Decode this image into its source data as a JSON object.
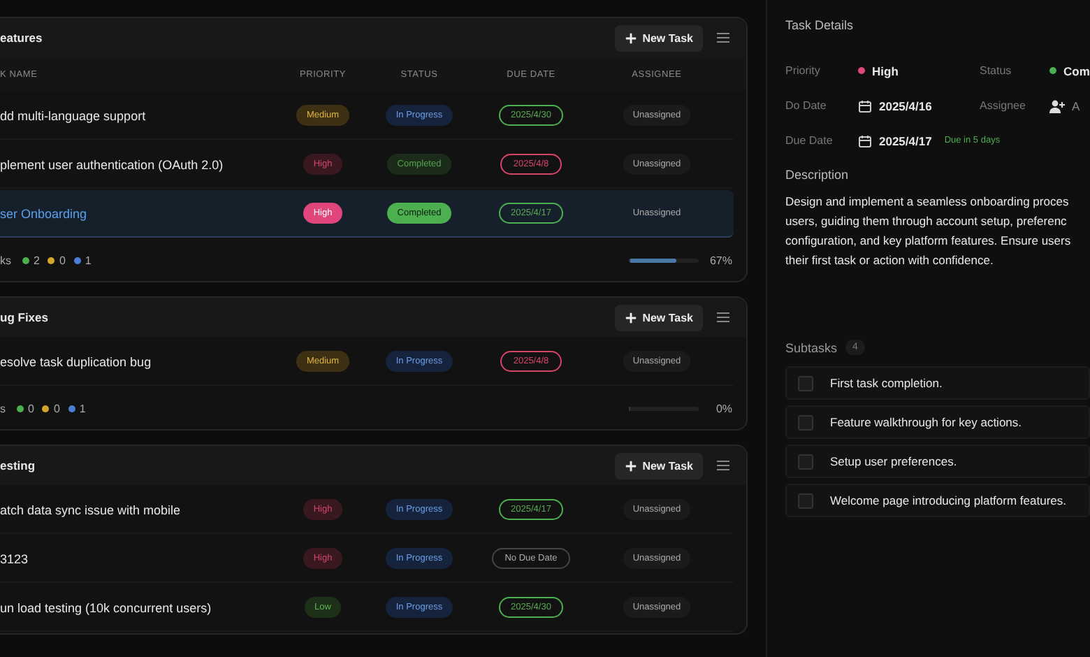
{
  "groups": [
    {
      "title": "eatures",
      "new_task": "New Task",
      "columns": [
        "K NAME",
        "PRIORITY",
        "STATUS",
        "DUE DATE",
        "ASSIGNEE"
      ],
      "tasks": [
        {
          "name": "dd multi-language support",
          "selected": false,
          "priority": {
            "label": "Medium",
            "kind": "medium"
          },
          "status": {
            "label": "In Progress",
            "kind": "progress"
          },
          "due": {
            "label": "2025/4/30",
            "kind": "ok"
          },
          "assignee": "Unassigned"
        },
        {
          "name": "plement user authentication (OAuth 2.0)",
          "selected": false,
          "priority": {
            "label": "High",
            "kind": "high"
          },
          "status": {
            "label": "Completed",
            "kind": "done"
          },
          "due": {
            "label": "2025/4/8",
            "kind": "overdue"
          },
          "assignee": "Unassigned"
        },
        {
          "name": "ser Onboarding",
          "selected": true,
          "priority": {
            "label": "High",
            "kind": "high"
          },
          "status": {
            "label": "Completed",
            "kind": "done"
          },
          "due": {
            "label": "2025/4/17",
            "kind": "ok"
          },
          "assignee": "Unassigned"
        }
      ],
      "footer": {
        "label": "ks",
        "counts": [
          {
            "value": "2",
            "color": "#4caf50"
          },
          {
            "value": "0",
            "color": "#d4a72c"
          },
          {
            "value": "1",
            "color": "#4a7fd4"
          }
        ],
        "level": 0.67,
        "percent": "67%"
      }
    },
    {
      "title": "ug Fixes",
      "new_task": "New Task",
      "tasks": [
        {
          "name": "esolve task duplication bug",
          "selected": false,
          "priority": {
            "label": "Medium",
            "kind": "medium"
          },
          "status": {
            "label": "In Progress",
            "kind": "progress"
          },
          "due": {
            "label": "2025/4/8",
            "kind": "overdue"
          },
          "assignee": "Unassigned"
        }
      ],
      "footer": {
        "label": "s",
        "counts": [
          {
            "value": "0",
            "color": "#4caf50"
          },
          {
            "value": "0",
            "color": "#d4a72c"
          },
          {
            "value": "1",
            "color": "#4a7fd4"
          }
        ],
        "level": 0,
        "percent": "0%"
      }
    },
    {
      "title": "esting",
      "new_task": "New Task",
      "tasks": [
        {
          "name": "atch data sync issue with mobile",
          "selected": false,
          "priority": {
            "label": "High",
            "kind": "high"
          },
          "status": {
            "label": "In Progress",
            "kind": "progress"
          },
          "due": {
            "label": "2025/4/17",
            "kind": "ok"
          },
          "assignee": "Unassigned"
        },
        {
          "name": "3123",
          "selected": false,
          "priority": {
            "label": "High",
            "kind": "high"
          },
          "status": {
            "label": "In Progress",
            "kind": "progress"
          },
          "due": {
            "label": "No Due Date",
            "kind": "none"
          },
          "assignee": "Unassigned"
        },
        {
          "name": "un load testing (10k concurrent users)",
          "selected": false,
          "priority": {
            "label": "Low",
            "kind": "low"
          },
          "status": {
            "label": "In Progress",
            "kind": "progress"
          },
          "due": {
            "label": "2025/4/30",
            "kind": "ok"
          },
          "assignee": "Unassigned"
        }
      ]
    }
  ],
  "details": {
    "title": "Task Details",
    "priority": {
      "label": "Priority",
      "value": "High",
      "color": "#e0457b"
    },
    "status": {
      "label": "Status",
      "value": "Com",
      "color": "#4caf50"
    },
    "do_date": {
      "label": "Do Date",
      "value": "2025/4/16"
    },
    "assignee": {
      "label": "Assignee",
      "value": "A"
    },
    "due_date": {
      "label": "Due Date",
      "value": "2025/4/17",
      "note": "Due in 5 days"
    },
    "description_title": "Description",
    "description_lines": [
      "Design and implement a seamless onboarding proces",
      "users, guiding them through account setup, preferenc",
      "configuration, and key platform features. Ensure users",
      "their first task or action with confidence."
    ],
    "subtasks_title": "Subtasks",
    "subtasks_count": "4",
    "subtasks": [
      {
        "text": "First task completion.",
        "checked": false
      },
      {
        "text": "Feature walkthrough for key actions.",
        "checked": false
      },
      {
        "text": "Setup user preferences.",
        "checked": false
      },
      {
        "text": "Welcome page introducing platform features.",
        "checked": false
      }
    ]
  }
}
